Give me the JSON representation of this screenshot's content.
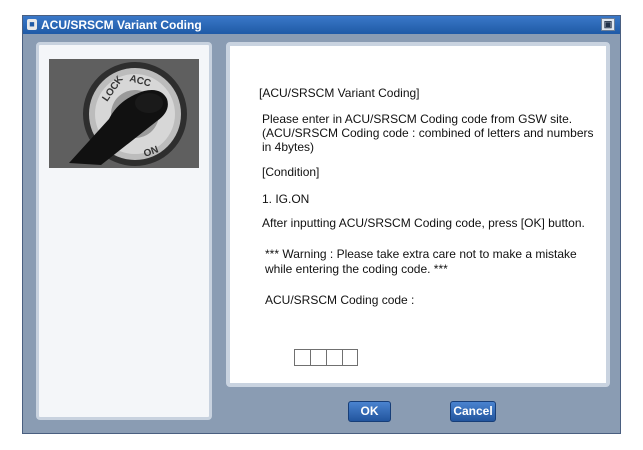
{
  "window": {
    "title": "ACU/SRSCM Variant Coding"
  },
  "instructions": {
    "heading": "[ACU/SRSCM Variant Coding]",
    "line1": "Please enter in ACU/SRSCM Coding code from GSW site.",
    "line2": "(ACU/SRSCM Coding code : combined of letters and numbers",
    "line3": "in 4bytes)",
    "condition_heading": "[Condition]",
    "condition_1": "1. IG.ON",
    "after_input": "After inputting ACU/SRSCM Coding code, press [OK] button.",
    "warning_line1": "*** Warning : Please take extra care not to make a mistake",
    "warning_line2": "while entering the coding code. ***",
    "code_label": "ACU/SRSCM Coding code :"
  },
  "coding_code": [
    "",
    "",
    "",
    ""
  ],
  "image": {
    "description_icon": "ignition-key-switch",
    "labels": [
      "LOCK",
      "ACC",
      "ON"
    ]
  },
  "buttons": {
    "ok": "OK",
    "cancel": "Cancel"
  }
}
